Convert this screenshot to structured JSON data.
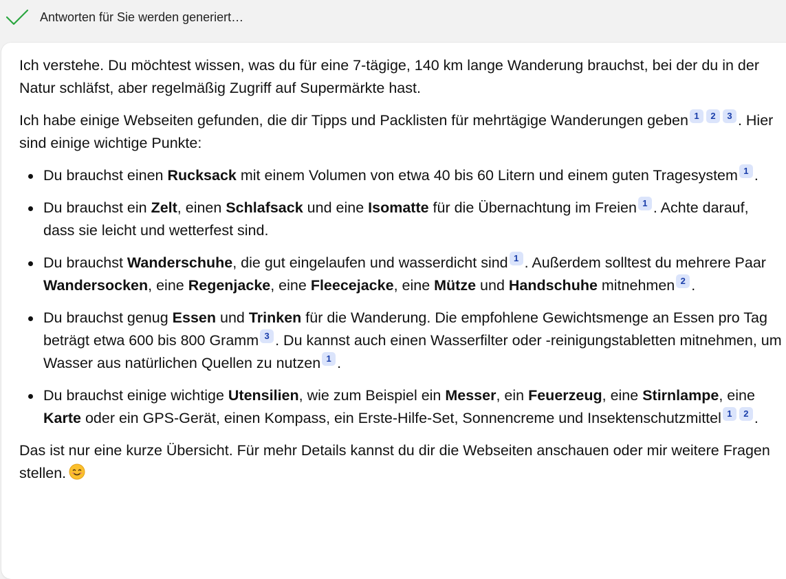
{
  "status": {
    "icon": "checkmark-icon",
    "text": "Antworten für Sie werden generiert…",
    "icon_color": "#2aa63f"
  },
  "message": {
    "intro": "Ich verstehe. Du möchtest wissen, was du für eine 7-tägige, 140 km lange Wanderung brauchst, bei der du in der Natur schläfst, aber regelmäßig Zugriff auf Supermärkte hast.",
    "found_before": "Ich habe einige Webseiten gefunden, die dir Tipps und Packlisten für mehrtägige Wanderungen geben",
    "found_cites": [
      "1",
      "2",
      "3"
    ],
    "found_after": ". Hier sind einige wichtige Punkte:",
    "bullets": [
      {
        "parts": [
          {
            "t": "Du brauchst einen "
          },
          {
            "b": "Rucksack"
          },
          {
            "t": " mit einem Volumen von etwa 40 bis 60 Litern und einem guten Tragesystem"
          },
          {
            "c": "1"
          },
          {
            "t": "."
          }
        ]
      },
      {
        "parts": [
          {
            "t": "Du brauchst ein "
          },
          {
            "b": "Zelt"
          },
          {
            "t": ", einen "
          },
          {
            "b": "Schlafsack"
          },
          {
            "t": " und eine "
          },
          {
            "b": "Isomatte"
          },
          {
            "t": " für die Übernachtung im Freien"
          },
          {
            "c": "1"
          },
          {
            "t": ". Achte darauf, dass sie leicht und wetterfest sind."
          }
        ]
      },
      {
        "parts": [
          {
            "t": "Du brauchst "
          },
          {
            "b": "Wanderschuhe"
          },
          {
            "t": ", die gut eingelaufen und wasserdicht sind"
          },
          {
            "c": "1"
          },
          {
            "t": ". Außerdem solltest du mehrere Paar "
          },
          {
            "b": "Wandersocken"
          },
          {
            "t": ", eine "
          },
          {
            "b": "Regenjacke"
          },
          {
            "t": ", eine "
          },
          {
            "b": "Fleecejacke"
          },
          {
            "t": ", eine "
          },
          {
            "b": "Mütze"
          },
          {
            "t": " und "
          },
          {
            "b": "Handschuhe"
          },
          {
            "t": " mitnehmen"
          },
          {
            "c": "2"
          },
          {
            "t": "."
          }
        ]
      },
      {
        "parts": [
          {
            "t": "Du brauchst genug "
          },
          {
            "b": "Essen"
          },
          {
            "t": " und "
          },
          {
            "b": "Trinken"
          },
          {
            "t": " für die Wanderung. Die empfohlene Gewichtsmenge an Essen pro Tag beträgt etwa 600 bis 800 Gramm"
          },
          {
            "c": "3"
          },
          {
            "t": ". Du kannst auch einen Wasserfilter oder -reinigungstabletten mitnehmen, um Wasser aus natürlichen Quellen zu nutzen"
          },
          {
            "c": "1"
          },
          {
            "t": "."
          }
        ]
      },
      {
        "parts": [
          {
            "t": "Du brauchst einige wichtige "
          },
          {
            "b": "Utensilien"
          },
          {
            "t": ", wie zum Beispiel ein "
          },
          {
            "b": "Messer"
          },
          {
            "t": ", ein "
          },
          {
            "b": "Feuerzeug"
          },
          {
            "t": ", eine "
          },
          {
            "b": "Stirnlampe"
          },
          {
            "t": ", eine "
          },
          {
            "b": "Karte"
          },
          {
            "t": " oder ein GPS-Gerät, einen Kompass, ein Erste-Hilfe-Set, Sonnencreme und Insektenschutzmittel"
          },
          {
            "c": "1"
          },
          {
            "c": "2"
          },
          {
            "t": "."
          }
        ]
      }
    ],
    "outro": "Das ist nur eine kurze Übersicht. Für mehr Details kannst du dir die Webseiten anschauen oder mir weitere Fragen stellen.",
    "outro_icon": "smiling-face-emoji-icon"
  }
}
